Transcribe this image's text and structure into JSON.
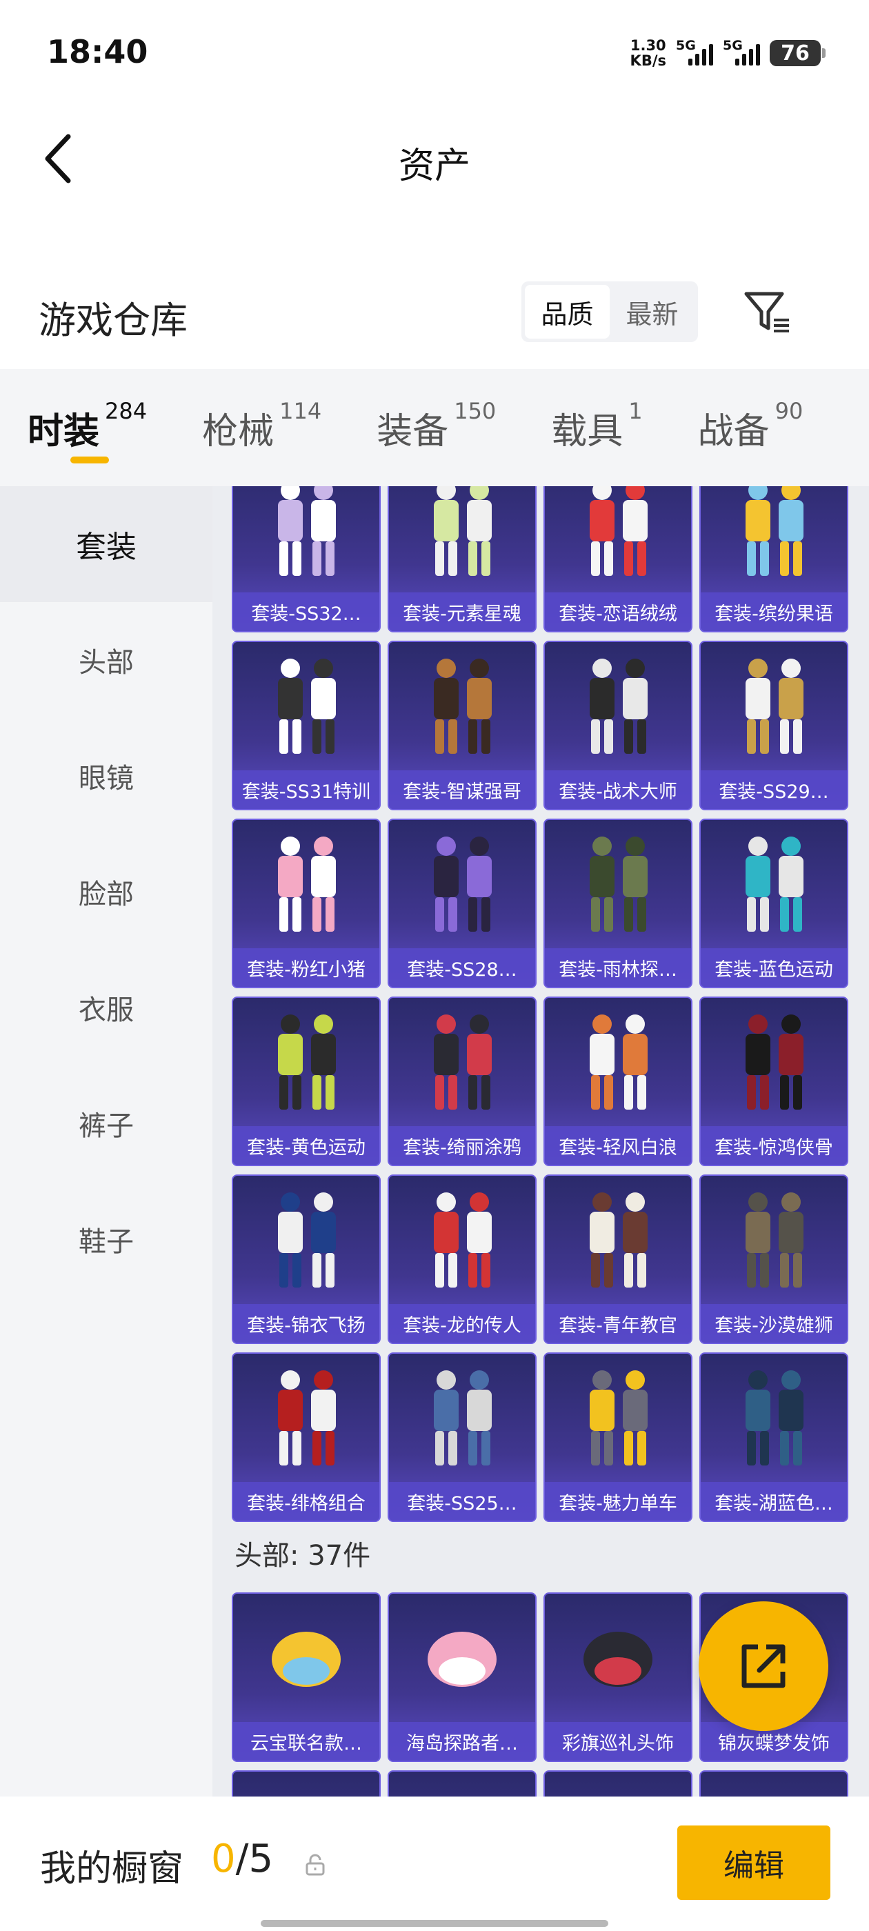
{
  "status_bar": {
    "time": "18:40",
    "speed_value": "1.30",
    "speed_unit": "KB/s",
    "sim1_label": "5G",
    "sim2_label": "5G",
    "battery": "76"
  },
  "nav": {
    "title": "资产"
  },
  "header": {
    "title": "游戏仓库",
    "sort_options": [
      "品质",
      "最新"
    ],
    "sort_selected": "品质"
  },
  "tabs": [
    {
      "label": "时装",
      "count": "284"
    },
    {
      "label": "枪械",
      "count": "114"
    },
    {
      "label": "装备",
      "count": "150"
    },
    {
      "label": "载具",
      "count": "1"
    },
    {
      "label": "战备",
      "count": "90"
    }
  ],
  "active_tab": "时装",
  "sidebar": {
    "items": [
      {
        "label": "套装"
      },
      {
        "label": "头部"
      },
      {
        "label": "眼镜"
      },
      {
        "label": "脸部"
      },
      {
        "label": "衣服"
      },
      {
        "label": "裤子"
      },
      {
        "label": "鞋子"
      }
    ],
    "active": "套装"
  },
  "suits": [
    "套装-SS32…",
    "套装-元素星魂",
    "套装-恋语绒绒",
    "套装-缤纷果语",
    "套装-SS31特训",
    "套装-智谋强哥",
    "套装-战术大师",
    "套装-SS29…",
    "套装-粉红小猪",
    "套装-SS28…",
    "套装-雨林探…",
    "套装-蓝色运动",
    "套装-黄色运动",
    "套装-绮丽涂鸦",
    "套装-轻风白浪",
    "套装-惊鸿侠骨",
    "套装-锦衣飞扬",
    "套装-龙的传人",
    "套装-青年教官",
    "套装-沙漠雄狮",
    "套装-绯格组合",
    "套装-SS25…",
    "套装-魅力单车",
    "套装-湖蓝色…"
  ],
  "head_section": {
    "label": "头部: 37件",
    "items": [
      "云宝联名款…",
      "海岛探路者…",
      "彩旗巡礼头饰",
      "锦灰蝶梦发饰"
    ]
  },
  "bottom": {
    "title": "我的橱窗",
    "current": "0",
    "total": "/5",
    "edit_label": "编辑"
  },
  "colors": {
    "accent": "#f7b500",
    "card_bg": "#40368f",
    "card_label_bg": "#5648c8"
  }
}
